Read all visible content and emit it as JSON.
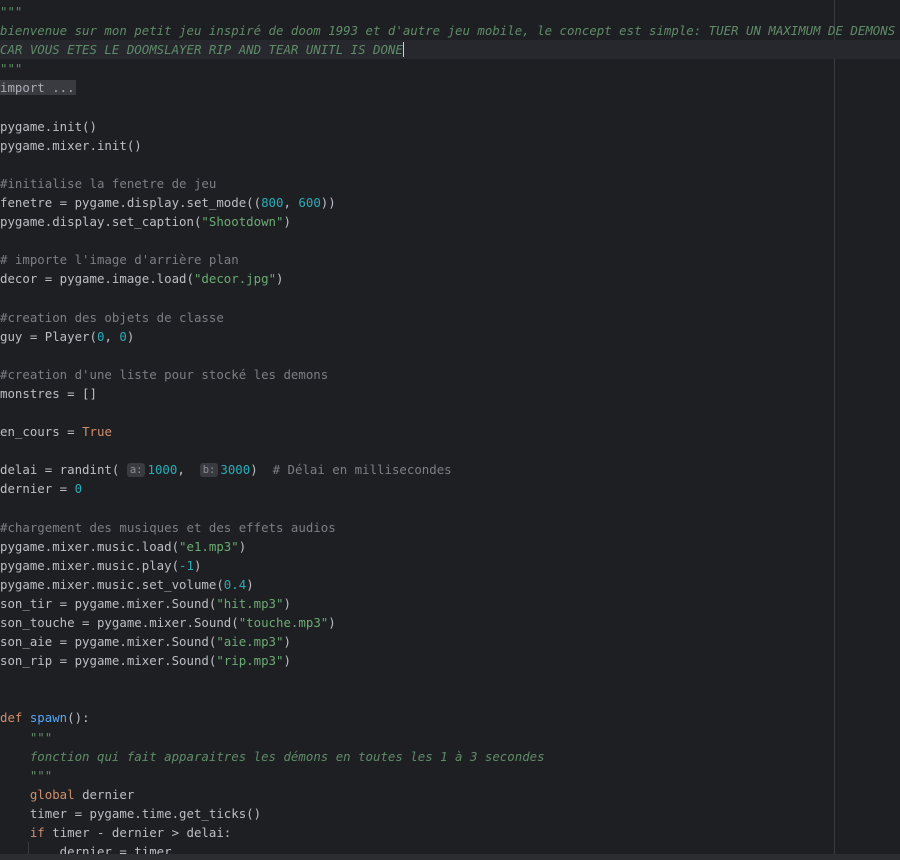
{
  "editor": {
    "lines": [
      {
        "segs": [
          {
            "t": "\"\"\"",
            "c": "docstring"
          }
        ]
      },
      {
        "segs": [
          {
            "t": "bienvenue sur mon petit jeu inspiré de doom 1993 et d'autre jeu mobile, le concept est simple: TUER UN MAXIMUM DE DEMONS",
            "c": "docstring"
          }
        ]
      },
      {
        "current": true,
        "caret": true,
        "segs": [
          {
            "t": "CAR VOUS ETES LE DOOMSLAYER RIP AND TEAR UNITL IS DONE",
            "c": "docstring"
          }
        ]
      },
      {
        "segs": [
          {
            "t": "\"\"\"",
            "c": "docstring"
          }
        ]
      },
      {
        "segs": [
          {
            "t": "import ...",
            "c": "fold"
          }
        ]
      },
      {
        "segs": []
      },
      {
        "segs": [
          {
            "t": "pygame.init()"
          }
        ]
      },
      {
        "segs": [
          {
            "t": "pygame.mixer.init()"
          }
        ]
      },
      {
        "segs": []
      },
      {
        "segs": [
          {
            "t": "#initialise la fenetre de jeu",
            "c": "comment"
          }
        ]
      },
      {
        "segs": [
          {
            "t": "fenetre = pygame.display.set_mode(("
          },
          {
            "t": "800",
            "c": "num"
          },
          {
            "t": ", "
          },
          {
            "t": "600",
            "c": "num"
          },
          {
            "t": "))"
          }
        ]
      },
      {
        "segs": [
          {
            "t": "pygame.display.set_caption("
          },
          {
            "t": "\"Shootdown\"",
            "c": "str"
          },
          {
            "t": ")"
          }
        ]
      },
      {
        "segs": []
      },
      {
        "segs": [
          {
            "t": "# importe l'image d'arrière plan",
            "c": "comment"
          }
        ]
      },
      {
        "segs": [
          {
            "t": "decor = pygame.image.load("
          },
          {
            "t": "\"decor.jpg\"",
            "c": "str"
          },
          {
            "t": ")"
          }
        ]
      },
      {
        "segs": []
      },
      {
        "segs": [
          {
            "t": "#creation des objets de classe",
            "c": "comment"
          }
        ]
      },
      {
        "segs": [
          {
            "t": "guy = Player("
          },
          {
            "t": "0",
            "c": "num"
          },
          {
            "t": ", "
          },
          {
            "t": "0",
            "c": "num"
          },
          {
            "t": ")"
          }
        ]
      },
      {
        "segs": []
      },
      {
        "segs": [
          {
            "t": "#creation d'une liste pour stocké les demons",
            "c": "comment"
          }
        ]
      },
      {
        "segs": [
          {
            "t": "monstres = []"
          }
        ]
      },
      {
        "segs": []
      },
      {
        "segs": [
          {
            "t": "en_cours = "
          },
          {
            "t": "True",
            "c": "kw"
          }
        ]
      },
      {
        "segs": []
      },
      {
        "segs": [
          {
            "t": "delai = randint( "
          },
          {
            "t": "a:",
            "c": "hint"
          },
          {
            "t": "1000",
            "c": "num"
          },
          {
            "t": ",  "
          },
          {
            "t": "b:",
            "c": "hint"
          },
          {
            "t": "3000",
            "c": "num"
          },
          {
            "t": ")  "
          },
          {
            "t": "# Délai en millisecondes",
            "c": "comment"
          }
        ]
      },
      {
        "segs": [
          {
            "t": "dernier = "
          },
          {
            "t": "0",
            "c": "num"
          }
        ]
      },
      {
        "segs": []
      },
      {
        "segs": [
          {
            "t": "#chargement des musiques et des effets audios",
            "c": "comment"
          }
        ]
      },
      {
        "segs": [
          {
            "t": "pygame.mixer.music.load("
          },
          {
            "t": "\"e1.mp3\"",
            "c": "str"
          },
          {
            "t": ")"
          }
        ]
      },
      {
        "segs": [
          {
            "t": "pygame.mixer.music.play("
          },
          {
            "t": "-1",
            "c": "num"
          },
          {
            "t": ")"
          }
        ]
      },
      {
        "segs": [
          {
            "t": "pygame.mixer.music.set_volume("
          },
          {
            "t": "0.4",
            "c": "num"
          },
          {
            "t": ")"
          }
        ]
      },
      {
        "segs": [
          {
            "t": "son_tir = pygame.mixer.Sound("
          },
          {
            "t": "\"hit.mp3\"",
            "c": "str"
          },
          {
            "t": ")"
          }
        ]
      },
      {
        "segs": [
          {
            "t": "son_touche = pygame.mixer.Sound("
          },
          {
            "t": "\"touche.mp3\"",
            "c": "str"
          },
          {
            "t": ")"
          }
        ]
      },
      {
        "segs": [
          {
            "t": "son_aie = pygame.mixer.Sound("
          },
          {
            "t": "\"aie.mp3\"",
            "c": "str"
          },
          {
            "t": ")"
          }
        ]
      },
      {
        "segs": [
          {
            "t": "son_rip = pygame.mixer.Sound("
          },
          {
            "t": "\"rip.mp3\"",
            "c": "str"
          },
          {
            "t": ")"
          }
        ]
      },
      {
        "segs": []
      },
      {
        "segs": []
      },
      {
        "segs": [
          {
            "t": "def ",
            "c": "kw"
          },
          {
            "t": "spawn",
            "c": "fn"
          },
          {
            "t": "():"
          }
        ]
      },
      {
        "segs": [
          {
            "t": "    "
          },
          {
            "t": "\"\"\"",
            "c": "docstring"
          }
        ]
      },
      {
        "segs": [
          {
            "t": "    "
          },
          {
            "t": "fonction qui fait apparaitres les démons en toutes les 1 à 3 secondes",
            "c": "docstring"
          }
        ]
      },
      {
        "segs": [
          {
            "t": "    "
          },
          {
            "t": "\"\"\"",
            "c": "docstring"
          }
        ]
      },
      {
        "segs": [
          {
            "t": "    "
          },
          {
            "t": "global ",
            "c": "kw"
          },
          {
            "t": "dernier"
          }
        ]
      },
      {
        "segs": [
          {
            "t": "    timer = pygame.time.get_ticks()"
          }
        ]
      },
      {
        "segs": [
          {
            "t": "    "
          },
          {
            "t": "if ",
            "c": "kw"
          },
          {
            "t": "timer - dernier > delai:"
          }
        ]
      },
      {
        "guide": true,
        "segs": [
          {
            "t": "        dernier = timer"
          }
        ]
      }
    ]
  }
}
